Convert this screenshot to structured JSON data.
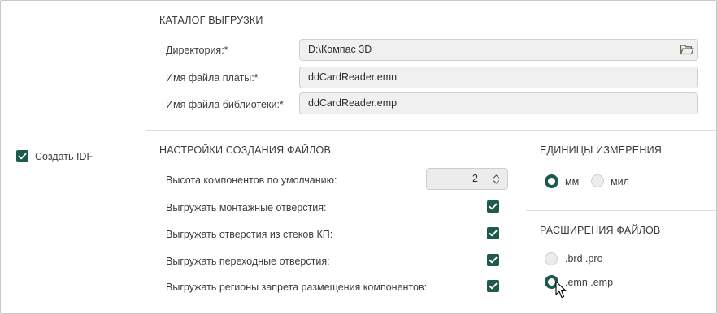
{
  "export_dir": {
    "title": "КАТАЛОГ ВЫГРУЗКИ",
    "directory_label": "Директория:*",
    "directory_value": "D:\\Компас 3D",
    "board_file_label": "Имя файла платы:*",
    "board_file_value": "ddCardReader.emn",
    "library_file_label": "Имя файла библиотеки:*",
    "library_file_value": "ddCardReader.emp"
  },
  "create_idf": {
    "label": "Создать IDF",
    "checked": true
  },
  "file_settings": {
    "title": "НАСТРОЙКИ СОЗДАНИЯ ФАЙЛОВ",
    "height_label": "Высота компонентов по умолчанию:",
    "height_value": "2",
    "options": [
      {
        "label": "Выгружать монтажные отверстия:",
        "checked": true
      },
      {
        "label": "Выгружать отверстия из стеков КП:",
        "checked": true
      },
      {
        "label": "Выгружать переходные отверстия:",
        "checked": true
      },
      {
        "label": "Выгружать регионы запрета размещения компонентов:",
        "checked": true
      }
    ]
  },
  "units": {
    "title": "ЕДИНИЦЫ ИЗМЕРЕНИЯ",
    "options": [
      {
        "label": "мм",
        "selected": true
      },
      {
        "label": "мил",
        "selected": false
      }
    ]
  },
  "extensions": {
    "title": "РАСШИРЕНИЯ ФАЙЛОВ",
    "options": [
      {
        "label": ".brd .pro",
        "selected": false
      },
      {
        "label": ".emn .emp",
        "selected": true
      }
    ]
  },
  "colors": {
    "accent": "#1f5a4f",
    "field_bg": "#f0f0f0",
    "border": "#cfcfcf"
  },
  "icons": {
    "folder": "folder-icon",
    "check": "check-icon",
    "spinner": "chevron-up-down-icon",
    "cursor": "mouse-pointer-icon"
  }
}
